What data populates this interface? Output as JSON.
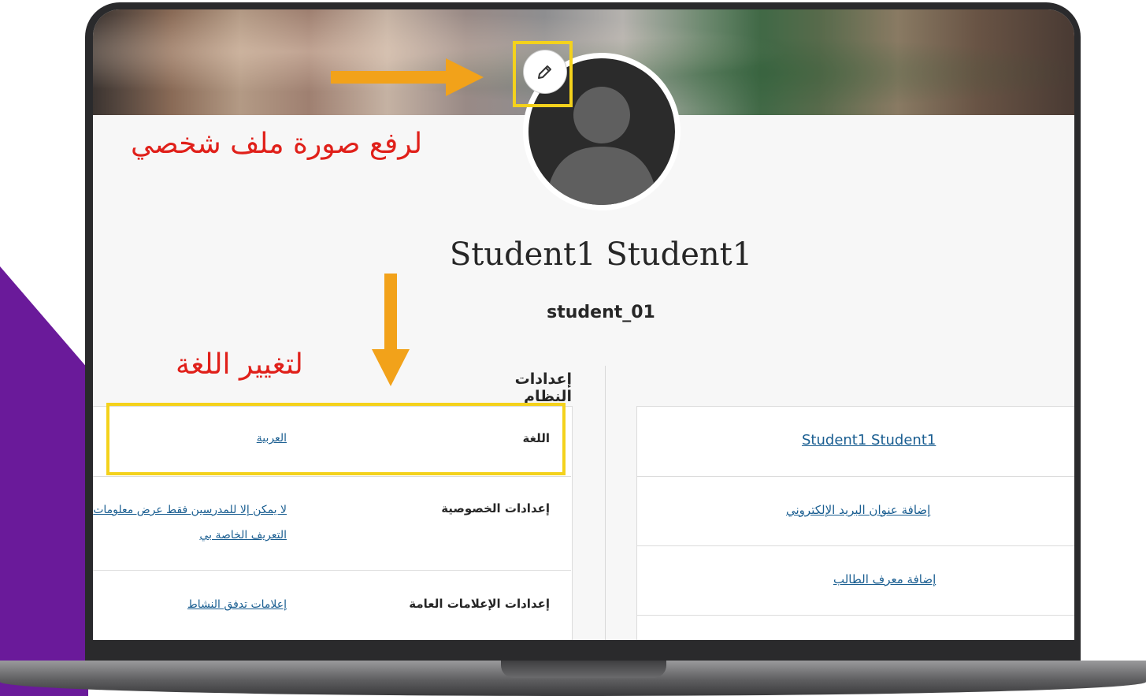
{
  "profile": {
    "full_name": "Student1 Student1",
    "username": "student_01",
    "edit_photo_icon": "pencil-icon"
  },
  "annotations": {
    "upload_photo": "لرفع صورة ملف شخصي",
    "change_language": "لتغيير اللغة"
  },
  "system_settings": {
    "title": "إعدادات النظام",
    "rows": [
      {
        "label": "اللغة",
        "value": "العربية"
      },
      {
        "label": "إعدادات الخصوصية",
        "value": "لا يمكن إلا للمدرسين فقط عرض معلومات التعريف الخاصة بي"
      },
      {
        "label": "إعدادات الإعلامات العامة",
        "value": "إعلامات تدفق النشاط"
      }
    ]
  },
  "basic_info": {
    "rows": [
      {
        "value": "Student1 Student1"
      },
      {
        "value": "إضافة عنوان البريد الإلكتروني"
      },
      {
        "value": "إضافة معرف الطالب"
      }
    ]
  },
  "colors": {
    "annotation_red": "#e0201a",
    "highlight_yellow": "#f4d21c",
    "arrow_orange": "#f2a21a",
    "link_blue": "#1a5e91",
    "brand_purple": "#6a1a9a"
  }
}
